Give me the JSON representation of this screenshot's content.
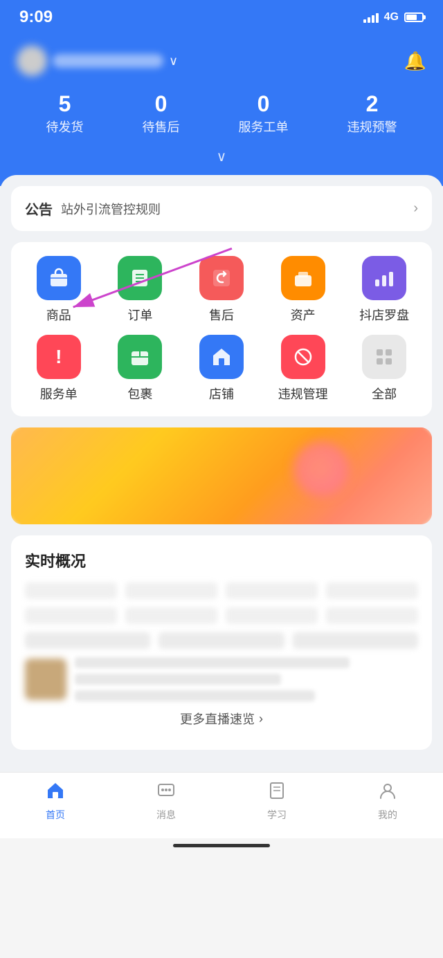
{
  "statusBar": {
    "time": "9:09",
    "network": "4G"
  },
  "header": {
    "storeName": "店铺名称",
    "bellLabel": "通知",
    "stats": [
      {
        "id": "pending-ship",
        "number": "5",
        "label": "待发货"
      },
      {
        "id": "pending-after",
        "number": "0",
        "label": "待售后"
      },
      {
        "id": "service-order",
        "number": "0",
        "label": "服务工单"
      },
      {
        "id": "violation",
        "number": "2",
        "label": "违规预警"
      }
    ],
    "expandLabel": "展开"
  },
  "announcement": {
    "label": "公告",
    "text": "站外引流管控规则",
    "arrowLabel": "查看详情"
  },
  "menu": {
    "rows": [
      [
        {
          "id": "goods",
          "icon": "🛍",
          "label": "商品",
          "color": "blue"
        },
        {
          "id": "orders",
          "icon": "📋",
          "label": "订单",
          "color": "green"
        },
        {
          "id": "aftersale",
          "icon": "↩",
          "label": "售后",
          "color": "red"
        },
        {
          "id": "assets",
          "icon": "📁",
          "label": "资产",
          "color": "orange"
        },
        {
          "id": "compass",
          "icon": "📊",
          "label": "抖店罗盘",
          "color": "purple"
        }
      ],
      [
        {
          "id": "service",
          "icon": "!",
          "label": "服务单",
          "color": "red2"
        },
        {
          "id": "package",
          "icon": "📦",
          "label": "包裹",
          "color": "green2"
        },
        {
          "id": "store",
          "icon": "🏠",
          "label": "店铺",
          "color": "blue2"
        },
        {
          "id": "violation-mgmt",
          "icon": "⊘",
          "label": "违规管理",
          "color": "pink"
        },
        {
          "id": "all",
          "icon": "⊞",
          "label": "全部",
          "color": "gray"
        }
      ]
    ]
  },
  "realtime": {
    "title": "实时概况"
  },
  "moreLive": {
    "label": "更多直播速览",
    "arrowLabel": "前往"
  },
  "bottomNav": {
    "items": [
      {
        "id": "home",
        "label": "首页",
        "active": true
      },
      {
        "id": "message",
        "label": "消息",
        "active": false
      },
      {
        "id": "learning",
        "label": "学习",
        "active": false
      },
      {
        "id": "mine",
        "label": "我的",
        "active": false
      }
    ]
  }
}
